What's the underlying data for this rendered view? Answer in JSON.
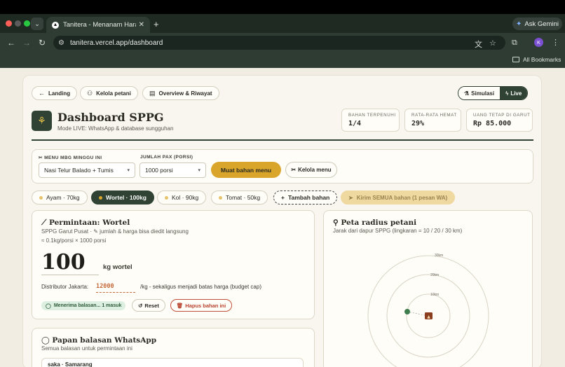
{
  "browser": {
    "tab_title": "Tanitera - Menanam Harapan",
    "url": "tanitera.vercel.app/dashboard",
    "gemini_label": "Ask Gemini",
    "avatar_letter": "K",
    "bookmarks_label": "All Bookmarks"
  },
  "nav": {
    "landing": "Landing",
    "kelola_petani": "Kelola petani",
    "overview": "Overview & Riwayat",
    "mode_sim": "Simulasi",
    "mode_live": "Live"
  },
  "header": {
    "title": "Dashboard SPPG",
    "subtitle": "Mode LIVE: WhatsApp & database sungguhan"
  },
  "stats": [
    {
      "label": "BAHAN TERPENUHI",
      "value": "1/4"
    },
    {
      "label": "RATA-RATA HEMAT",
      "value": "29%"
    },
    {
      "label": "UANG TETAP DI GARUT",
      "value": "Rp 85.000"
    }
  ],
  "form": {
    "menu_label": "MENU MBG MINGGU INI",
    "menu_value": "Nasi Telur Balado + Tumis",
    "pax_label": "JUMLAH PAX (PORSI)",
    "pax_value": "1000 porsi",
    "load_button": "Muat bahan menu",
    "kelola_menu_button": "Kelola menu"
  },
  "ingredients": [
    {
      "label": "Ayam · 70kg",
      "active": false
    },
    {
      "label": "Wortel · 100kg",
      "active": true
    },
    {
      "label": "Kol · 90kg",
      "active": false
    },
    {
      "label": "Tomat · 50kg",
      "active": false
    }
  ],
  "add_ingredient": "Tambah bahan",
  "send_all": "Kirim SEMUA bahan (1 pesan WA)",
  "request": {
    "title": "Permintaan: Wortel",
    "subtitle": "SPPG Garut Pusat · ✎ jumlah & harga bisa diedit langsung",
    "calc": "≈ 0.1kg/porsi × 1000 porsi",
    "amount": "100",
    "unit": "kg wortel",
    "distributor_label": "Distributor Jakarta:",
    "distributor_price": "12000",
    "price_note": "/kg - sekaligus menjadi batas harga (budget cap)",
    "status": "Menerima balasan... 1 masuk",
    "reset": "Reset",
    "delete": "Hapus bahan ini"
  },
  "map": {
    "title": "Peta radius petani",
    "subtitle": "Jarak dari dapur SPPG (lingkaran = 10 / 20 / 30 km)",
    "rings": [
      "10km",
      "20km",
      "30km"
    ]
  },
  "whatsapp": {
    "title": "Papan balasan WhatsApp",
    "subtitle": "Semua balasan untuk permintaan ini",
    "first_reply": "saka · Samarang"
  },
  "colors": {
    "primary": "#2f4233",
    "accent": "#d9a62b",
    "danger": "#b8412c",
    "background": "#f1ede2"
  }
}
